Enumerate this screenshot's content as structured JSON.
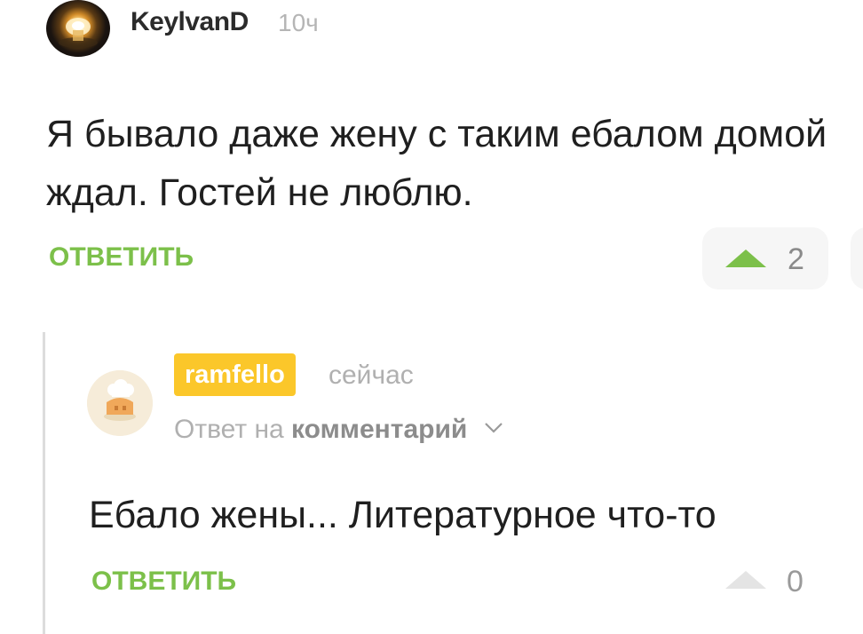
{
  "comment": {
    "author": "KeylvanD",
    "time": "10ч",
    "text": "Я бывало даже жену с таким ебалом домой ждал. Гостей не люблю.",
    "reply_label": "ОТВЕТИТЬ",
    "votes": "2",
    "accent_color": "#7cc04a"
  },
  "reply": {
    "author": "ramfello",
    "time": "сейчас",
    "reply_to_prefix": "Ответ на",
    "reply_to_link": "комментарий",
    "text": "Ебало жены... Литературное что-то",
    "reply_label": "ОТВЕТИТЬ",
    "votes": "0",
    "badge_color": "#fbc72a"
  },
  "icons": {
    "upvote": "triangle-up-icon",
    "expand": "chevron-down-icon"
  }
}
